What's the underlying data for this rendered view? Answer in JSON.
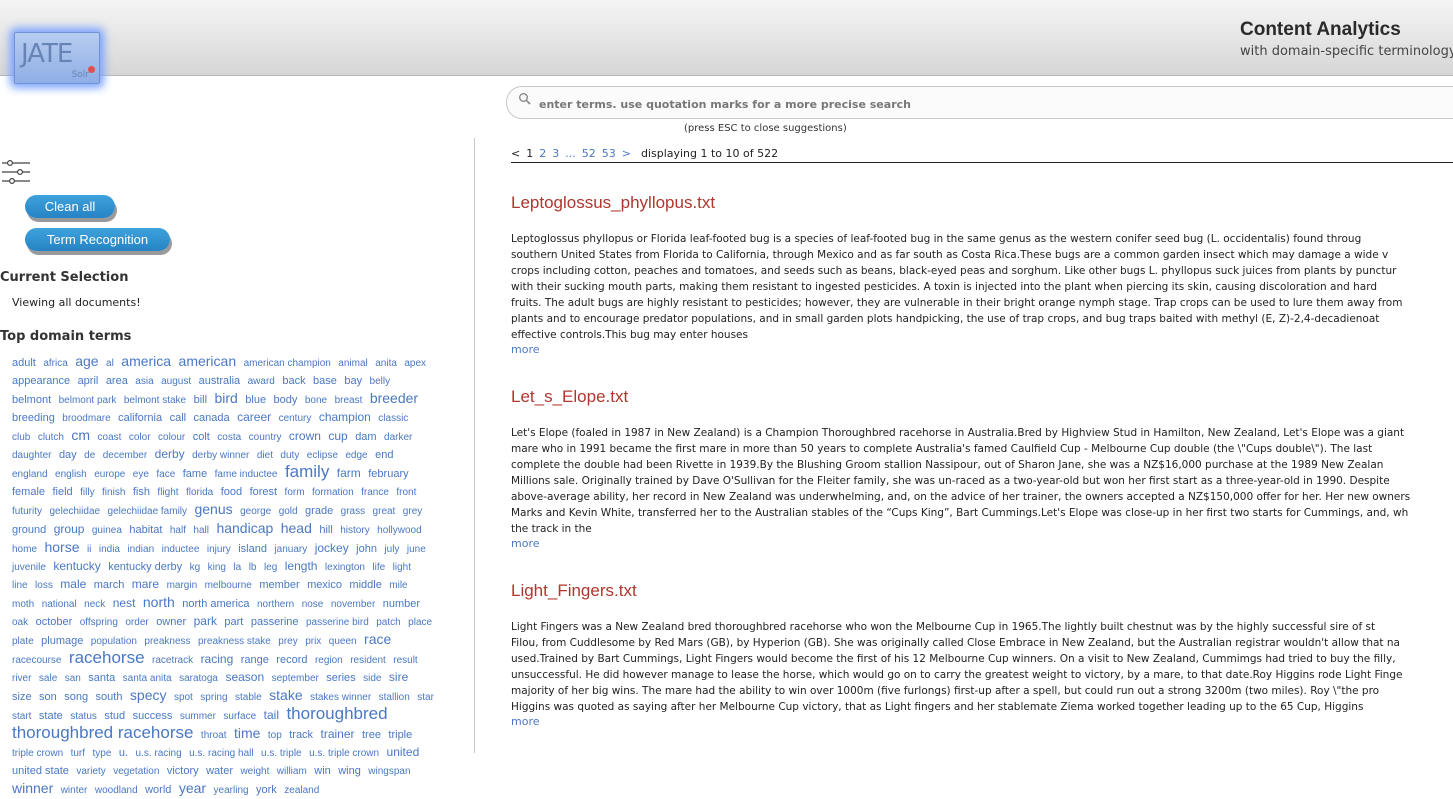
{
  "header": {
    "logo_text": "JATE",
    "logo_sub": "Solr",
    "title": "Content Analytics",
    "subtitle": "with domain-specific terminology"
  },
  "search": {
    "placeholder": "enter terms. use quotation marks for a more precise search",
    "hint": "(press ESC to close suggestions)"
  },
  "sidebar": {
    "clean_all_label": "Clean all",
    "term_recognition_label": "Term Recognition",
    "current_selection_heading": "Current Selection",
    "current_selection_text": "Viewing all documents!",
    "top_terms_heading": "Top domain terms",
    "terms": [
      [
        "adult",
        2
      ],
      [
        "africa",
        1
      ],
      [
        "age",
        4
      ],
      [
        "al",
        1
      ],
      [
        "america",
        4
      ],
      [
        "american",
        4
      ],
      [
        "american champion",
        1
      ],
      [
        "animal",
        1
      ],
      [
        "anita",
        1
      ],
      [
        "apex",
        1
      ],
      [
        "appearance",
        2
      ],
      [
        "april",
        2
      ],
      [
        "area",
        2
      ],
      [
        "asia",
        1
      ],
      [
        "august",
        1
      ],
      [
        "australia",
        2
      ],
      [
        "award",
        1
      ],
      [
        "back",
        2
      ],
      [
        "base",
        2
      ],
      [
        "bay",
        2
      ],
      [
        "belly",
        1
      ],
      [
        "belmont",
        2
      ],
      [
        "belmont park",
        1
      ],
      [
        "belmont stake",
        1
      ],
      [
        "bill",
        2
      ],
      [
        "bird",
        4
      ],
      [
        "blue",
        2
      ],
      [
        "body",
        2
      ],
      [
        "bone",
        1
      ],
      [
        "breast",
        1
      ],
      [
        "breeder",
        4
      ],
      [
        "breeding",
        2
      ],
      [
        "broodmare",
        1
      ],
      [
        "california",
        2
      ],
      [
        "call",
        2
      ],
      [
        "canada",
        2
      ],
      [
        "career",
        3
      ],
      [
        "century",
        1
      ],
      [
        "champion",
        3
      ],
      [
        "classic",
        1
      ],
      [
        "club",
        1
      ],
      [
        "clutch",
        1
      ],
      [
        "cm",
        4
      ],
      [
        "coast",
        1
      ],
      [
        "color",
        1
      ],
      [
        "colour",
        1
      ],
      [
        "colt",
        2
      ],
      [
        "costa",
        1
      ],
      [
        "country",
        1
      ],
      [
        "crown",
        3
      ],
      [
        "cup",
        3
      ],
      [
        "dam",
        2
      ],
      [
        "darker",
        1
      ],
      [
        "daughter",
        1
      ],
      [
        "day",
        2
      ],
      [
        "de",
        1
      ],
      [
        "december",
        1
      ],
      [
        "derby",
        3
      ],
      [
        "derby winner",
        1
      ],
      [
        "diet",
        1
      ],
      [
        "duty",
        1
      ],
      [
        "eclipse",
        1
      ],
      [
        "edge",
        1
      ],
      [
        "end",
        2
      ],
      [
        "england",
        1
      ],
      [
        "english",
        1
      ],
      [
        "europe",
        1
      ],
      [
        "eye",
        1
      ],
      [
        "face",
        1
      ],
      [
        "fame",
        2
      ],
      [
        "fame inductee",
        1
      ],
      [
        "family",
        5
      ],
      [
        "farm",
        3
      ],
      [
        "february",
        2
      ],
      [
        "female",
        2
      ],
      [
        "field",
        2
      ],
      [
        "filly",
        1
      ],
      [
        "finish",
        1
      ],
      [
        "fish",
        2
      ],
      [
        "flight",
        1
      ],
      [
        "florida",
        1
      ],
      [
        "food",
        2
      ],
      [
        "forest",
        2
      ],
      [
        "form",
        1
      ],
      [
        "formation",
        1
      ],
      [
        "france",
        1
      ],
      [
        "front",
        1
      ],
      [
        "futurity",
        1
      ],
      [
        "gelechiidae",
        1
      ],
      [
        "gelechiidae family",
        1
      ],
      [
        "genus",
        4
      ],
      [
        "george",
        1
      ],
      [
        "gold",
        1
      ],
      [
        "grade",
        2
      ],
      [
        "grass",
        1
      ],
      [
        "great",
        1
      ],
      [
        "grey",
        1
      ],
      [
        "ground",
        2
      ],
      [
        "group",
        3
      ],
      [
        "guinea",
        1
      ],
      [
        "habitat",
        2
      ],
      [
        "half",
        1
      ],
      [
        "hall",
        1
      ],
      [
        "handicap",
        4
      ],
      [
        "head",
        4
      ],
      [
        "hill",
        2
      ],
      [
        "history",
        1
      ],
      [
        "hollywood",
        1
      ],
      [
        "home",
        1
      ],
      [
        "horse",
        4
      ],
      [
        "ii",
        1
      ],
      [
        "india",
        1
      ],
      [
        "indian",
        1
      ],
      [
        "inductee",
        1
      ],
      [
        "injury",
        1
      ],
      [
        "island",
        2
      ],
      [
        "january",
        1
      ],
      [
        "jockey",
        3
      ],
      [
        "john",
        2
      ],
      [
        "july",
        1
      ],
      [
        "june",
        1
      ],
      [
        "juvenile",
        1
      ],
      [
        "kentucky",
        3
      ],
      [
        "kentucky derby",
        2
      ],
      [
        "kg",
        1
      ],
      [
        "king",
        1
      ],
      [
        "la",
        1
      ],
      [
        "lb",
        1
      ],
      [
        "leg",
        1
      ],
      [
        "length",
        3
      ],
      [
        "lexington",
        1
      ],
      [
        "life",
        1
      ],
      [
        "light",
        1
      ],
      [
        "line",
        1
      ],
      [
        "loss",
        1
      ],
      [
        "male",
        3
      ],
      [
        "march",
        2
      ],
      [
        "mare",
        3
      ],
      [
        "margin",
        1
      ],
      [
        "melbourne",
        1
      ],
      [
        "member",
        2
      ],
      [
        "mexico",
        2
      ],
      [
        "middle",
        2
      ],
      [
        "mile",
        1
      ],
      [
        "moth",
        1
      ],
      [
        "national",
        1
      ],
      [
        "neck",
        1
      ],
      [
        "nest",
        3
      ],
      [
        "north",
        4
      ],
      [
        "north america",
        2
      ],
      [
        "northern",
        1
      ],
      [
        "nose",
        1
      ],
      [
        "november",
        1
      ],
      [
        "number",
        2
      ],
      [
        "oak",
        1
      ],
      [
        "october",
        2
      ],
      [
        "offspring",
        1
      ],
      [
        "order",
        1
      ],
      [
        "owner",
        2
      ],
      [
        "park",
        3
      ],
      [
        "part",
        2
      ],
      [
        "passerine",
        2
      ],
      [
        "passerine bird",
        1
      ],
      [
        "patch",
        1
      ],
      [
        "place",
        1
      ],
      [
        "plate",
        1
      ],
      [
        "plumage",
        2
      ],
      [
        "population",
        1
      ],
      [
        "preakness",
        1
      ],
      [
        "preakness stake",
        1
      ],
      [
        "prey",
        1
      ],
      [
        "prix",
        1
      ],
      [
        "queen",
        1
      ],
      [
        "race",
        4
      ],
      [
        "racecourse",
        1
      ],
      [
        "racehorse",
        5
      ],
      [
        "racetrack",
        1
      ],
      [
        "racing",
        3
      ],
      [
        "range",
        2
      ],
      [
        "record",
        2
      ],
      [
        "region",
        1
      ],
      [
        "resident",
        1
      ],
      [
        "result",
        1
      ],
      [
        "river",
        1
      ],
      [
        "sale",
        1
      ],
      [
        "san",
        1
      ],
      [
        "santa",
        2
      ],
      [
        "santa anita",
        1
      ],
      [
        "saratoga",
        1
      ],
      [
        "season",
        3
      ],
      [
        "september",
        1
      ],
      [
        "series",
        2
      ],
      [
        "side",
        1
      ],
      [
        "sire",
        3
      ],
      [
        "size",
        2
      ],
      [
        "son",
        2
      ],
      [
        "song",
        2
      ],
      [
        "south",
        2
      ],
      [
        "specy",
        4
      ],
      [
        "spot",
        1
      ],
      [
        "spring",
        1
      ],
      [
        "stable",
        1
      ],
      [
        "stake",
        4
      ],
      [
        "stakes winner",
        1
      ],
      [
        "stallion",
        1
      ],
      [
        "star",
        1
      ],
      [
        "start",
        1
      ],
      [
        "state",
        2
      ],
      [
        "status",
        1
      ],
      [
        "stud",
        2
      ],
      [
        "success",
        2
      ],
      [
        "summer",
        1
      ],
      [
        "surface",
        1
      ],
      [
        "tail",
        3
      ],
      [
        "thoroughbred",
        5
      ],
      [
        "thoroughbred racehorse",
        5
      ],
      [
        "throat",
        1
      ],
      [
        "time",
        4
      ],
      [
        "top",
        1
      ],
      [
        "track",
        2
      ],
      [
        "trainer",
        3
      ],
      [
        "tree",
        2
      ],
      [
        "triple",
        2
      ],
      [
        "triple crown",
        1
      ],
      [
        "turf",
        1
      ],
      [
        "type",
        1
      ],
      [
        "u.",
        2
      ],
      [
        "u.s. racing",
        1
      ],
      [
        "u.s. racing hall",
        1
      ],
      [
        "u.s. triple",
        1
      ],
      [
        "u.s. triple crown",
        1
      ],
      [
        "united",
        3
      ],
      [
        "united state",
        2
      ],
      [
        "variety",
        1
      ],
      [
        "vegetation",
        1
      ],
      [
        "victory",
        2
      ],
      [
        "water",
        2
      ],
      [
        "weight",
        1
      ],
      [
        "william",
        1
      ],
      [
        "win",
        2
      ],
      [
        "wing",
        2
      ],
      [
        "wingspan",
        1
      ],
      [
        "winner",
        4
      ],
      [
        "winter",
        1
      ],
      [
        "woodland",
        1
      ],
      [
        "world",
        2
      ],
      [
        "year",
        4
      ],
      [
        "yearling",
        1
      ],
      [
        "york",
        2
      ],
      [
        "zealand",
        1
      ]
    ]
  },
  "pagination": {
    "prev": "<",
    "current": "1",
    "pages": [
      "2",
      "3"
    ],
    "ellipsis": "...",
    "last_pages": [
      "52",
      "53"
    ],
    "next": ">",
    "info": "displaying 1 to 10 of 522"
  },
  "results": [
    {
      "title": "Leptoglossus_phyllopus.txt",
      "lines": [
        "Leptoglossus phyllopus or Florida leaf-footed bug is a species of leaf-footed bug in the same genus as the western conifer seed bug (L. occidentalis) found throug",
        "southern United States from Florida to California, through Mexico and as far south as Costa Rica.These bugs are a common garden insect which may damage a wide v",
        "crops including cotton, peaches and tomatoes, and seeds such as beans, black-eyed peas and sorghum. Like other bugs L. phyllopus suck juices from plants by punctur",
        "with their sucking mouth parts, making them resistant to ingested pesticides. A toxin is injected into the plant when piercing its skin, causing discoloration and hard",
        "fruits. The adult bugs are highly resistant to pesticides; however, they are vulnerable in their bright orange nymph stage. Trap crops can be used to lure them away from",
        "plants and to encourage predator populations, and in small garden plots handpicking, the use of trap crops, and bug traps baited with methyl (E, Z)-2,4-decadienoat",
        "effective controls.This bug may enter houses"
      ],
      "more": "more"
    },
    {
      "title": "Let_s_Elope.txt",
      "lines": [
        "Let's Elope (foaled in 1987 in New Zealand) is a Champion Thoroughbred racehorse in Australia.Bred by Highview Stud in Hamilton, New Zealand, Let's Elope was a giant",
        "mare who in 1991 became the first mare in more than 50 years to complete Australia's famed Caulfield Cup - Melbourne Cup double (the \\\"Cups double\\\"). The last",
        "complete the double had been Rivette in 1939.By the Blushing Groom stallion Nassipour, out of Sharon Jane, she was a NZ$16,000 purchase at the 1989 New Zealan",
        "Millions sale. Originally trained by Dave O'Sullivan for the Fleiter family, she was un-raced as a two-year-old but won her first start as a three-year-old in 1990. Despite",
        "above-average ability, her record in New Zealand was underwhelming, and, on the advice of her trainer, the owners accepted a NZ$150,000 offer for her. Her new owners",
        "Marks and Kevin White, transferred her to the Australian stables of the “Cups King”, Bart Cummings.Let's Elope was close-up in her first two starts for Cummings, and, wh",
        "the track in the"
      ],
      "more": "more"
    },
    {
      "title": "Light_Fingers.txt",
      "lines": [
        "Light Fingers was a New Zealand bred thoroughbred racehorse who won the Melbourne Cup in 1965.The lightly built chestnut was by the highly successful sire of st",
        "Filou, from Cuddlesome by Red Mars (GB), by Hyperion (GB). She was originally called Close Embrace in New Zealand, but the Australian registrar wouldn't allow that na",
        "used.Trained by Bart Cummings, Light Fingers would become the first of his 12 Melbourne Cup winners. On a visit to New Zealand, Cummimgs had tried to buy the filly,",
        "unsuccessful. He did however manage to lease the horse, which would go on to carry the greatest weight to victory, by a mare, to that date.Roy Higgins rode Light Finge",
        "majority of her big wins. The mare had the ability to win over 1000m (five furlongs) first-up after a spell, but could run out a strong 3200m (two miles). Roy \\\"the pro",
        "Higgins was quoted as saying after her Melbourne Cup victory, that as Light fingers and her stablemate Ziema worked together leading up to the 65 Cup, Higgins"
      ],
      "more": "more"
    }
  ]
}
